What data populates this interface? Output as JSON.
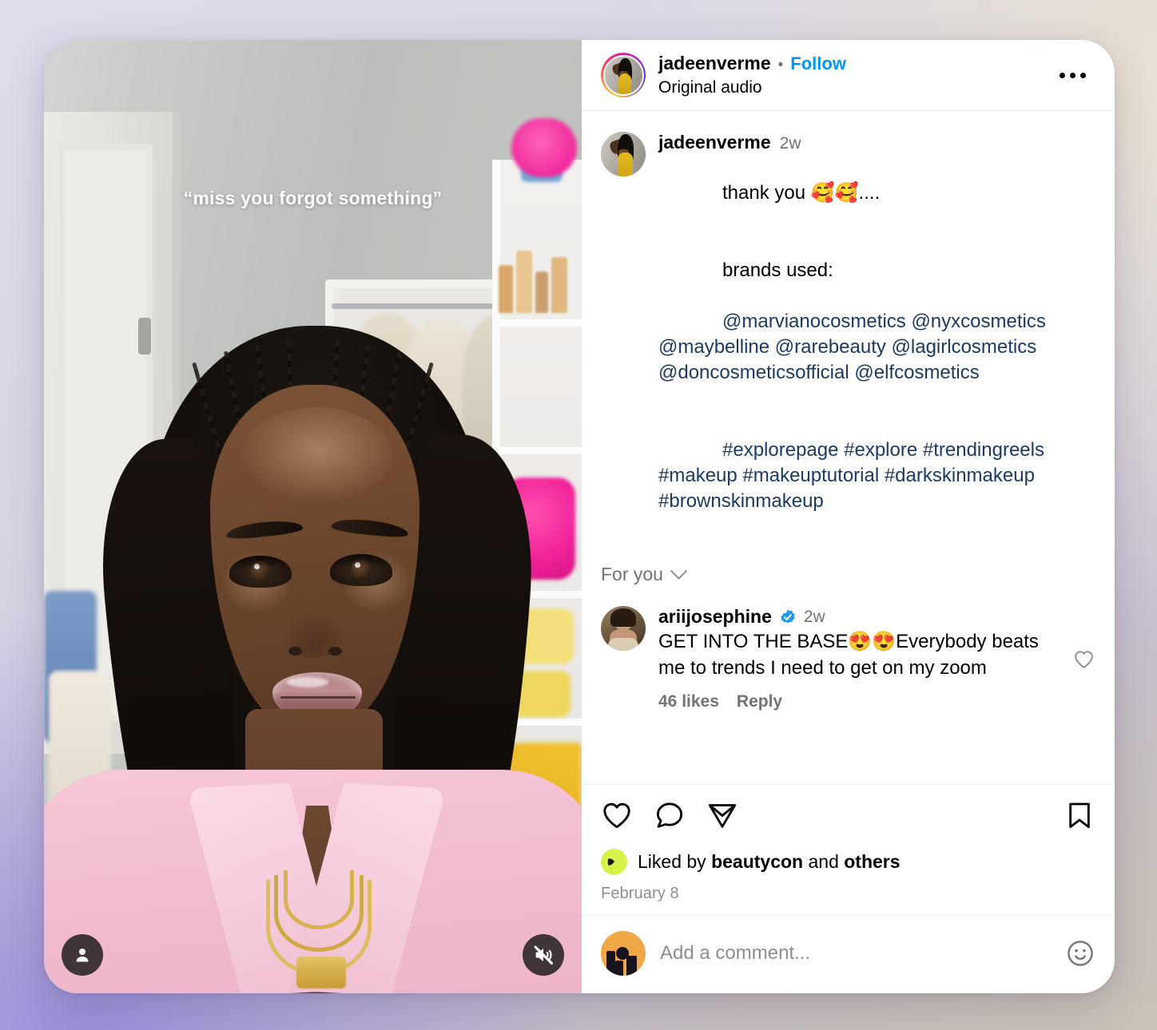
{
  "post": {
    "header": {
      "username": "jadeenverme",
      "separator": "•",
      "follow_label": "Follow",
      "audio_label": "Original audio",
      "more_icon": "more-options-icon",
      "avatar_icon": "profile-avatar-with-story-ring"
    },
    "video": {
      "overlay_caption": "“miss you forgot something”",
      "profile_button_icon": "person-icon",
      "mute_button_icon": "speaker-muted-icon"
    },
    "caption": {
      "username": "jadeenverme",
      "timestamp": "2w",
      "line_thanks": "thank you 🥰🥰....",
      "brands_label": "brands used:",
      "brand_mentions": "@marvianocosmetics @nyxcosmetics @maybelline @rarebeauty @lagirlcosmetics @doncosmeticsofficial @elfcosmetics",
      "hashtags": "#explorepage #explore #trendingreels #makeup #makeuptutorial #darkskinmakeup #brownskinmakeup"
    },
    "filter": {
      "label": "For you",
      "chevron_icon": "chevron-down-icon"
    },
    "comment": {
      "username": "ariijosephine",
      "verified_icon": "verified-badge-icon",
      "timestamp": "2w",
      "text": "GET INTO THE BASE😍😍Everybody beats me to trends I need to get on my zoom",
      "likes_label": "46 likes",
      "reply_label": "Reply",
      "like_icon": "heart-outline-icon"
    },
    "actions": {
      "like_icon": "heart-icon",
      "comment_icon": "comment-bubble-icon",
      "share_icon": "share-paper-plane-icon",
      "save_icon": "bookmark-icon"
    },
    "likes": {
      "prefix": "Liked by ",
      "liker": "beautycon",
      "middle": " and ",
      "suffix": "others",
      "liker_avatar_icon": "liker-avatar-icon"
    },
    "date": "February 8",
    "add_comment": {
      "placeholder": "Add a comment...",
      "value": "",
      "avatar_icon": "user-avatar-icon",
      "emoji_icon": "emoji-smiley-icon"
    }
  },
  "colors": {
    "accent_link": "#0095f6",
    "mention": "#1b3a66",
    "secondary_text": "#737373",
    "liker_badge": "#d4f24a"
  }
}
